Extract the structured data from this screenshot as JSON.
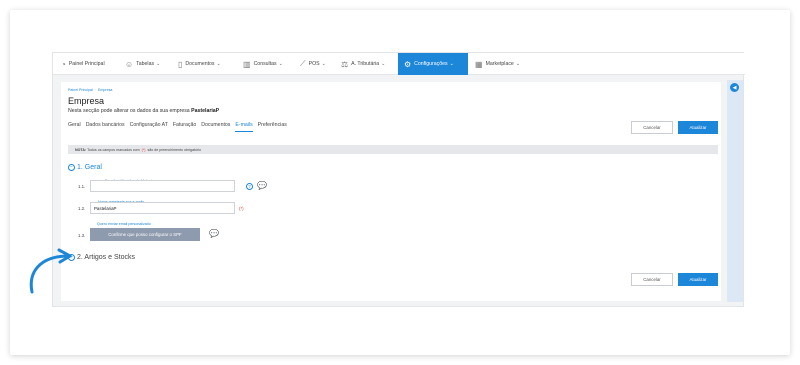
{
  "nav": {
    "items": [
      {
        "label": "Painel Principal",
        "icon": "dashboard-icon",
        "glyph": "◔",
        "chevron": ""
      },
      {
        "label": "Tabelas",
        "icon": "users-icon",
        "glyph": "☺",
        "chevron": "⌄"
      },
      {
        "label": "Documentos",
        "icon": "document-icon",
        "glyph": "▯",
        "chevron": "⌄"
      },
      {
        "label": "Consultas",
        "icon": "chart-icon",
        "glyph": "▥",
        "chevron": "⌄"
      },
      {
        "label": "POS",
        "icon": "pos-icon",
        "glyph": "⟋",
        "chevron": "⌄"
      },
      {
        "label": "A. Tributária",
        "icon": "tax-icon",
        "glyph": "⚖",
        "chevron": "⌄"
      },
      {
        "label": "Configurações",
        "icon": "settings-icon",
        "glyph": "⚙",
        "chevron": "⌄"
      },
      {
        "label": "Marketplace",
        "icon": "marketplace-icon",
        "glyph": "▦",
        "chevron": "⌄"
      }
    ],
    "active_index": 6
  },
  "breadcrumb": {
    "home": "Painel Principal",
    "current": "Empresa"
  },
  "page": {
    "title": "Empresa",
    "subtitle_prefix": "Nesta secção pode alterar os dados da sua empresa",
    "company": "PastelariaP"
  },
  "tabs": [
    "Geral",
    "Dados bancários",
    "Configuração AT",
    "Faturação",
    "Documentos",
    "E-mails",
    "Preferências"
  ],
  "active_tab": 5,
  "buttons": {
    "cancel": "Cancelar",
    "save": "Atualizar"
  },
  "note": {
    "label": "NOTA:",
    "text_before": "Todos os campos marcados com",
    "req": "(*)",
    "text_after": "são de preenchimento obrigatório"
  },
  "sections": [
    {
      "toggle": "−",
      "title": "1. Geral"
    },
    {
      "toggle": "+",
      "title": "2. Artigos e Stocks"
    }
  ],
  "fields": {
    "r1": {
      "num": "1.1.",
      "label": "E-mail notificações do Moloni",
      "value": ""
    },
    "r2": {
      "num": "1.2.",
      "label": "Nome remetente nos e-mails",
      "value": "PastelariaP",
      "required": "(*)"
    },
    "r3": {
      "num": "1.3.",
      "label": "Quero enviar email personalizado",
      "button": "Confirme que posso configurar o SPF"
    }
  },
  "help_glyph": "?",
  "colors": {
    "accent": "#1c86d9",
    "required": "#e53935",
    "gray_button": "#8e9aad"
  }
}
